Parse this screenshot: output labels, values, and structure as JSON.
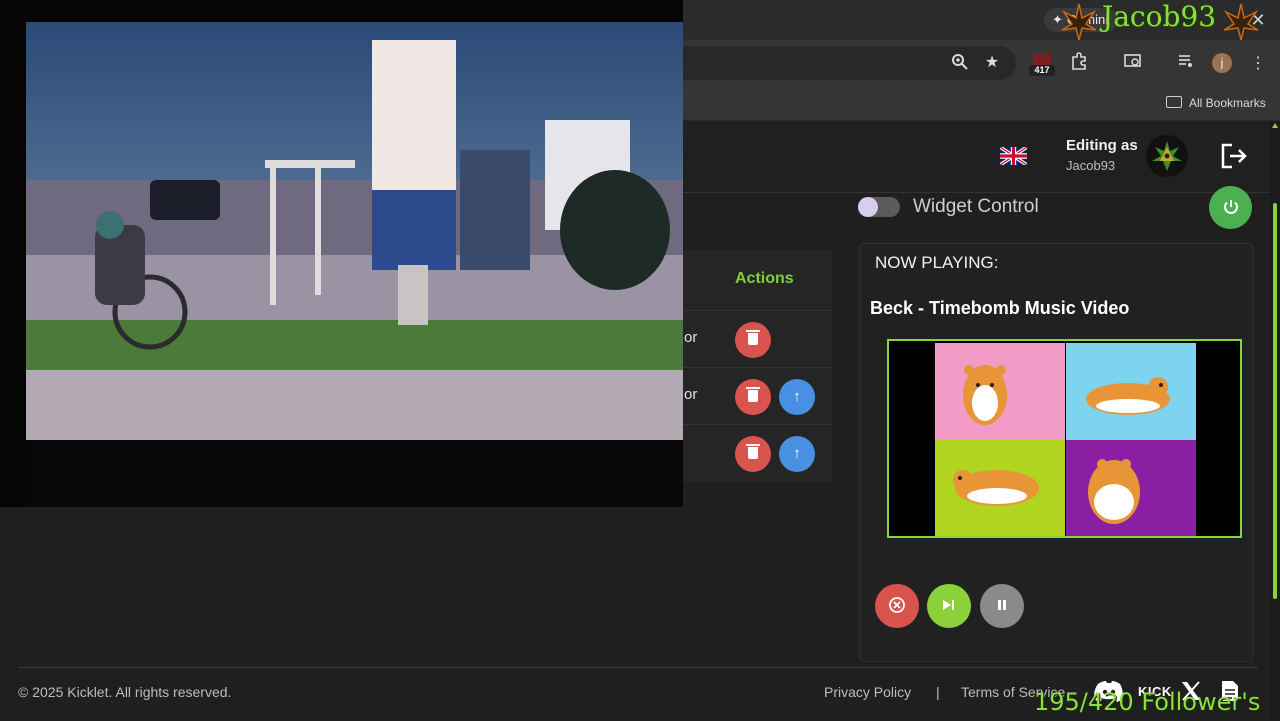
{
  "browser": {
    "gemini_label": "Gemini",
    "extension_badge": "417",
    "profile_initial": "j",
    "bookmarks_label": "All Bookmarks"
  },
  "header": {
    "editing_as": "Editing as",
    "username": "Jacob93"
  },
  "widget": {
    "label": "Widget Control",
    "enabled": false
  },
  "queue": {
    "actions_header": "Actions",
    "rows": [
      {
        "text_fragment": "or"
      },
      {
        "text_fragment": "or"
      },
      {
        "text_fragment": ""
      }
    ]
  },
  "now_playing": {
    "label": "NOW PLAYING:",
    "title": "Beck - Timebomb Music Video"
  },
  "footer": {
    "copyright": "© 2025 Kicklet. All rights reserved.",
    "privacy": "Privacy Policy",
    "separator": "|",
    "terms": "Terms of Service",
    "kick_label": "KICK"
  },
  "overlay": {
    "stream_name": "Jacob93",
    "followers": "195/420 Follower's"
  },
  "colors": {
    "accent_green": "#8bd13a",
    "delete_red": "#d9534f",
    "up_blue": "#4a90e2",
    "power_green": "#4caf50"
  }
}
